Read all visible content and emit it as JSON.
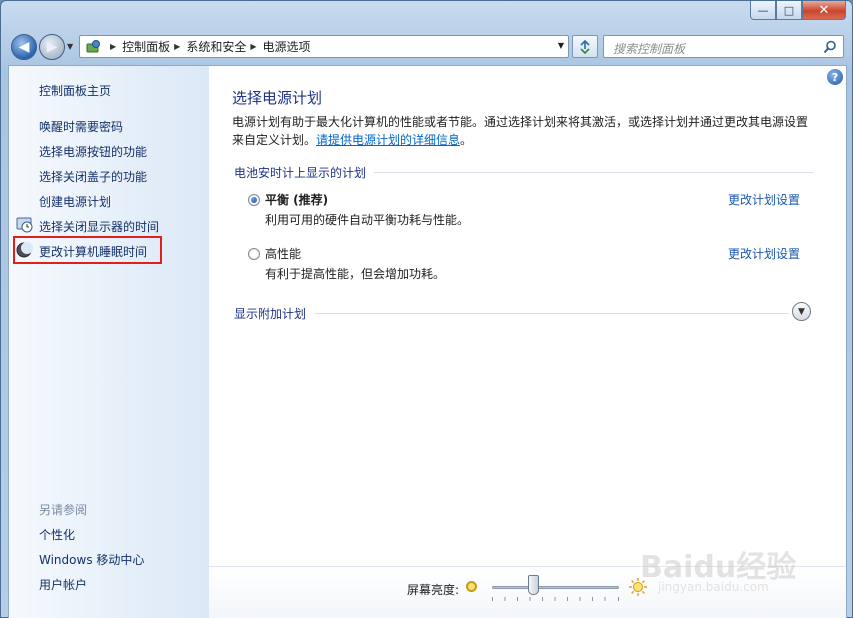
{
  "window": {
    "caption_min": "—",
    "caption_max": "□",
    "caption_close": "✕"
  },
  "navigation": {
    "back_glyph": "◀",
    "forward_glyph": "▶",
    "breadcrumbs": [
      "控制面板",
      "系统和安全",
      "电源选项"
    ],
    "search_placeholder": "搜索控制面板"
  },
  "sidebar": {
    "home_link": "控制面板主页",
    "items": [
      {
        "label": "唤醒时需要密码",
        "icon": ""
      },
      {
        "label": "选择电源按钮的功能",
        "icon": ""
      },
      {
        "label": "选择关闭盖子的功能",
        "icon": ""
      },
      {
        "label": "创建电源计划",
        "icon": ""
      },
      {
        "label": "选择关闭显示器的时间",
        "icon": "display-clock-icon"
      },
      {
        "label": "更改计算机睡眠时间",
        "icon": "moon-icon",
        "highlighted": true
      }
    ],
    "see_also_title": "另请参阅",
    "see_also_items": [
      "个性化",
      "Windows 移动中心",
      "用户帐户"
    ]
  },
  "main": {
    "title": "选择电源计划",
    "description_line1": "电源计划有助于最大化计算机的性能或者节能。通过选择计划来将其激活，或选择计划并通过更改其电源设置",
    "description_line2_prefix": "来自定义计划。",
    "description_link": "请提供电源计划的详细信息",
    "description_suffix": "。",
    "battery_group_title": "电池安时计上显示的计划",
    "plans": [
      {
        "name": "平衡 (推荐)",
        "description": "利用可用的硬件自动平衡功耗与性能。",
        "selected": true,
        "change_link": "更改计划设置"
      },
      {
        "name": "高性能",
        "description": "有利于提高性能，但会增加功耗。",
        "selected": false,
        "change_link": "更改计划设置"
      }
    ],
    "additional_plans_title": "显示附加计划",
    "brightness_label": "屏幕亮度:",
    "brightness_level": 0.33
  },
  "watermark": {
    "brand": "Baidu经验",
    "url": "jingyan.baidu.com"
  },
  "colors": {
    "link": "#1a56b0",
    "heading": "#1e3287",
    "highlight_border": "#e0201f"
  }
}
